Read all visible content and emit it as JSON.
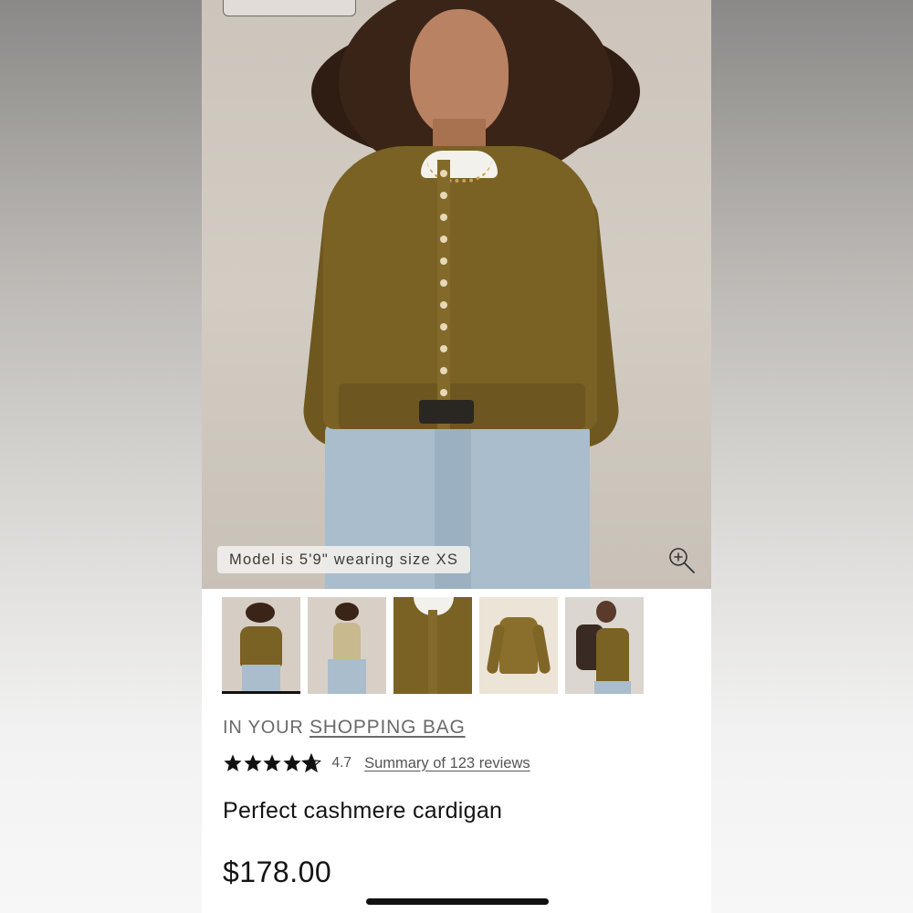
{
  "hero": {
    "model_caption": "Model is 5'9\" wearing size XS",
    "zoom_icon": "zoom-in-icon"
  },
  "thumbnails": [
    {
      "name": "thumbnail-front-view",
      "active": true
    },
    {
      "name": "thumbnail-side-view",
      "active": false
    },
    {
      "name": "thumbnail-detail-buttons",
      "active": false
    },
    {
      "name": "thumbnail-flat-lay",
      "active": false
    },
    {
      "name": "thumbnail-styled-jacket",
      "active": false
    }
  ],
  "bag": {
    "prefix": "IN YOUR",
    "link": "SHOPPING BAG"
  },
  "rating": {
    "value": "4.7",
    "stars": 4.7,
    "reviews_link": "Summary of 123 reviews"
  },
  "product": {
    "title": "Perfect cashmere cardigan",
    "price": "$178.00"
  },
  "colors": {
    "sweater": "#7a6124",
    "text": "#141414",
    "muted": "#6a6a6a"
  }
}
